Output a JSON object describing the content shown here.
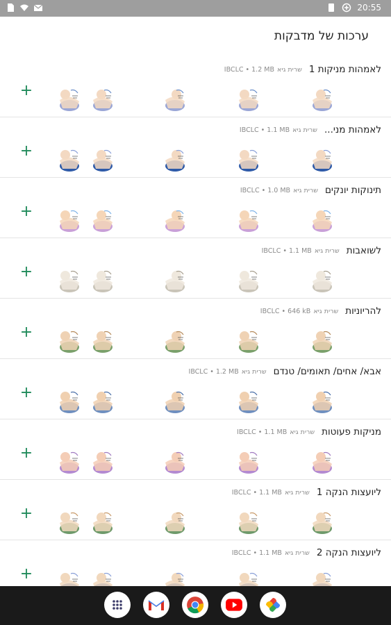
{
  "status": {
    "time": "20:55"
  },
  "appbar": {
    "title": "ערכות של מדבקות"
  },
  "packs": [
    {
      "name": "לאמהות מניקות 1",
      "author": "שרית גיא",
      "meta": "IBCLC • 1.2 MB"
    },
    {
      "name": "לאמהות מני...",
      "author": "שרית גיא",
      "meta": "IBCLC • 1.1 MB"
    },
    {
      "name": "תינוקות יונקים",
      "author": "שרית גיא",
      "meta": "IBCLC • 1.0 MB"
    },
    {
      "name": "לשואבות",
      "author": "שרית גיא",
      "meta": "IBCLC • 1.1 MB"
    },
    {
      "name": "להריוניות",
      "author": "שרית גיא",
      "meta": "IBCLC • 646 kB"
    },
    {
      "name": "אבא/ אחים/ תאומים/ טנדם",
      "author": "שרית גיא",
      "meta": "IBCLC • 1.2 MB"
    },
    {
      "name": "מניקות פעוטות",
      "author": "שרית גיא",
      "meta": "IBCLC • 1.1 MB"
    },
    {
      "name": "ליועצות הנקה 1",
      "author": "שרית גיא",
      "meta": "IBCLC • 1.1 MB"
    },
    {
      "name": "ליועצות הנקה 2",
      "author": "שרית גיא",
      "meta": "IBCLC • 1.1 MB"
    }
  ],
  "add_label": "+",
  "dock": [
    {
      "app": "app-drawer",
      "icon": "grid-icon"
    },
    {
      "app": "gmail",
      "icon": "gmail-icon"
    },
    {
      "app": "chrome",
      "icon": "chrome-icon"
    },
    {
      "app": "youtube",
      "icon": "youtube-icon"
    },
    {
      "app": "photos",
      "icon": "photos-icon"
    }
  ],
  "colors": {
    "accent": "#1f8a5a",
    "statusbar": "#9e9e9e",
    "navbar": "#1a1a1a"
  }
}
